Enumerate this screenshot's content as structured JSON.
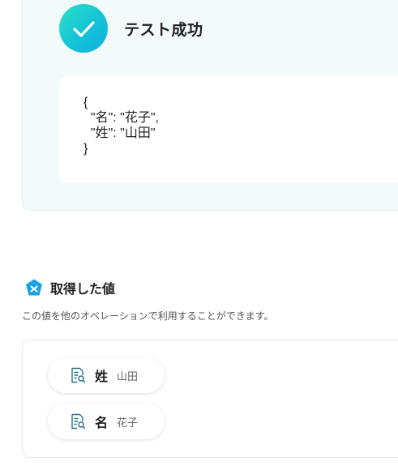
{
  "test_result": {
    "title": "テスト成功",
    "icon": "check-icon",
    "json_output": "{\n  \"名\": \"花子\",\n  \"姓\": \"山田\"\n}"
  },
  "acquired": {
    "title": "取得した値",
    "icon": "yoom-value-icon",
    "description": "この値を他のオペレーションで利用することができます。",
    "values": [
      {
        "key": "姓",
        "value": "山田",
        "icon": "document-search-icon"
      },
      {
        "key": "名",
        "value": "花子",
        "icon": "document-search-icon"
      }
    ]
  },
  "colors": {
    "accent": "#15c2d6",
    "panel_bg": "#f2fafa",
    "icon_blue": "#1aa1e6"
  }
}
